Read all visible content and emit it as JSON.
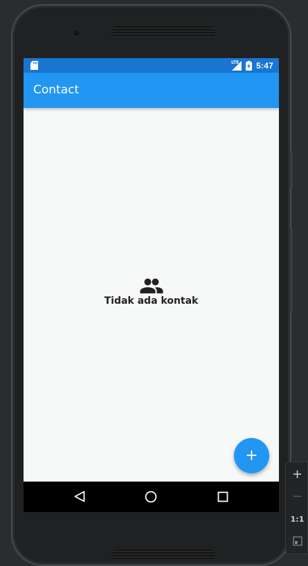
{
  "status_bar": {
    "time": "5:47",
    "network_label": "LTE",
    "icons": [
      "sd-card-icon",
      "lte-signal-icon",
      "battery-charging-icon"
    ]
  },
  "app_bar": {
    "title": "Contact"
  },
  "empty_state": {
    "icon": "people-icon",
    "message": "Tidak ada kontak"
  },
  "fab": {
    "icon": "plus",
    "label": "+"
  },
  "nav_bar": {
    "buttons": [
      "back-icon",
      "home-icon",
      "recents-icon"
    ]
  },
  "emulator_controls": {
    "zoom_in": "+",
    "zoom_out": "−",
    "actual_size": "1:1",
    "fit_icon": "fit-screen-icon"
  },
  "colors": {
    "status_bar": "#1976d2",
    "app_bar": "#2196f3",
    "background": "#f7f8f8",
    "accent": "#2196f3"
  }
}
